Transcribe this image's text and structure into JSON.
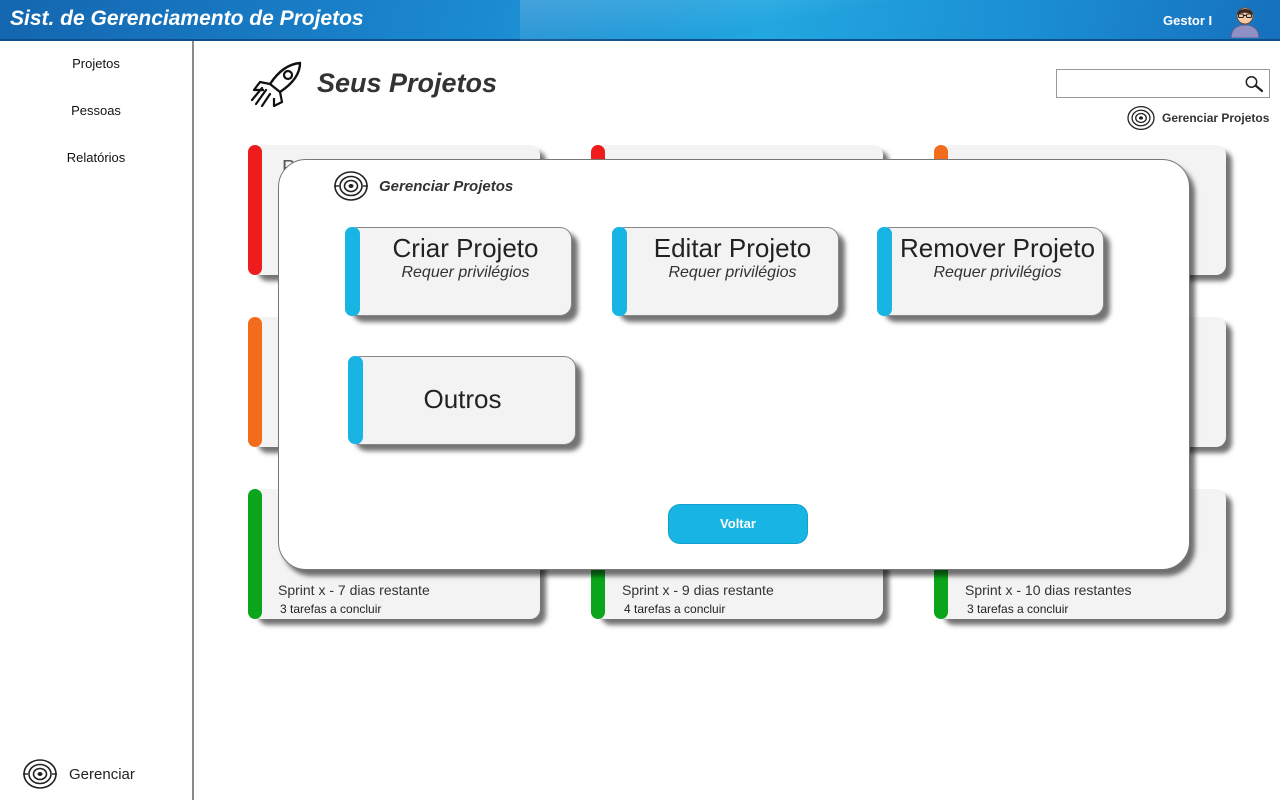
{
  "header": {
    "title": "Sist. de Gerenciamento de Projetos",
    "user": "Gestor I",
    "avatar_icon": "person-avatar-icon"
  },
  "sidebar": {
    "items": [
      {
        "label": "Projetos"
      },
      {
        "label": "Pessoas"
      },
      {
        "label": "Relatórios"
      }
    ],
    "manage": {
      "label": "Gerenciar",
      "icon": "target-icon"
    }
  },
  "main": {
    "title": "Seus Projetos",
    "title_icon": "rocket-icon",
    "search": {
      "value": "",
      "placeholder": "",
      "icon": "magnifier-icon"
    },
    "manage_projects_label": "Gerenciar Projetos",
    "cards": [
      {
        "color": "#ee1c1c",
        "peek": "P",
        "sprint": "",
        "tasks": ""
      },
      {
        "color": "#ee1c1c",
        "peek": "",
        "sprint": "",
        "tasks": ""
      },
      {
        "color": "#f26c1c",
        "peek": "",
        "sprint": "",
        "tasks": ""
      },
      {
        "color": "#f26c1c",
        "peek": "",
        "sprint": "",
        "tasks": ""
      },
      {
        "color": "#f26c1c",
        "peek": "",
        "sprint": "",
        "tasks": ""
      },
      {
        "color": "#f26c1c",
        "peek": "",
        "sprint": "",
        "tasks": ""
      },
      {
        "color": "#0aa51a",
        "peek": "",
        "sprint": "Sprint x - 7 dias restante",
        "tasks": "3 tarefas a concluir"
      },
      {
        "color": "#0aa51a",
        "peek": "",
        "sprint": "Sprint x - 9 dias restante",
        "tasks": "4 tarefas a concluir"
      },
      {
        "color": "#0aa51a",
        "peek": "",
        "sprint": "Sprint x - 10 dias restantes",
        "tasks": "3 tarefas a concluir"
      }
    ]
  },
  "modal": {
    "title": "Gerenciar Projetos",
    "actions": [
      {
        "label": "Criar Projeto",
        "sub": "Requer privilégios"
      },
      {
        "label": "Editar Projeto",
        "sub": "Requer privilégios"
      },
      {
        "label": "Remover Projeto",
        "sub": "Requer privilégios"
      },
      {
        "label": "Outros",
        "sub": ""
      }
    ],
    "back_label": "Voltar",
    "accent": "#17b4e4"
  }
}
